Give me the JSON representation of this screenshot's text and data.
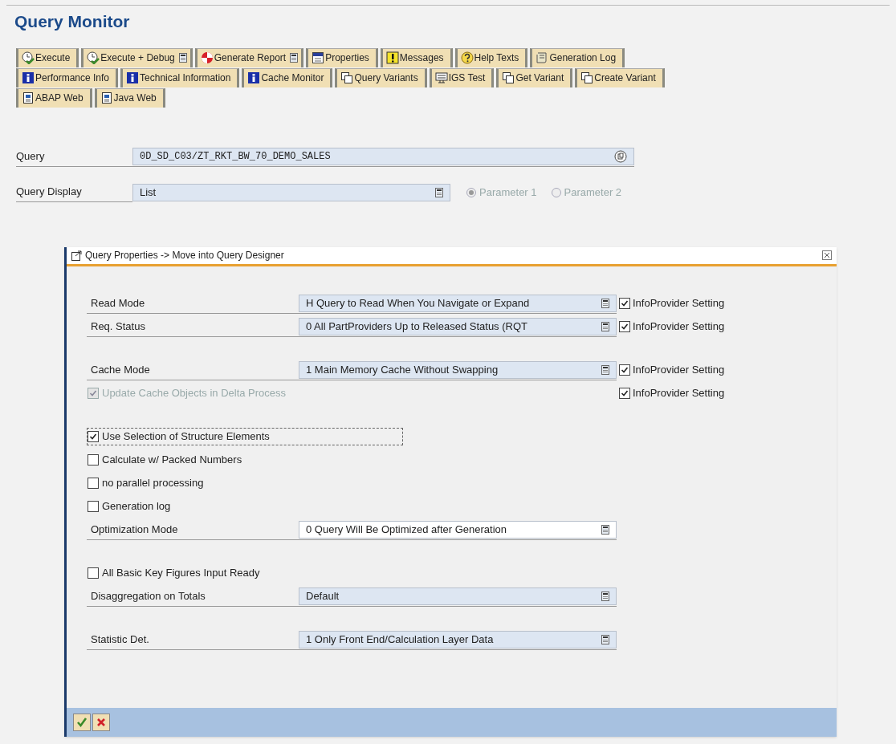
{
  "page": {
    "title": "Query Monitor"
  },
  "toolbar": [
    [
      {
        "label": "Execute",
        "kind": "execute",
        "dropdown": false
      },
      {
        "label": "Execute + Debug",
        "kind": "execute",
        "dropdown": true
      },
      {
        "label": "Generate Report",
        "kind": "generate",
        "dropdown": true
      },
      {
        "label": "Properties",
        "kind": "properties",
        "dropdown": false
      },
      {
        "label": "Messages",
        "kind": "messages",
        "dropdown": false
      },
      {
        "label": "Help Texts",
        "kind": "help",
        "dropdown": false
      },
      {
        "label": "Generation Log",
        "kind": "log",
        "dropdown": false
      }
    ],
    [
      {
        "label": "Performance Info",
        "kind": "info",
        "dropdown": false
      },
      {
        "label": "Technical Information",
        "kind": "info",
        "dropdown": false
      },
      {
        "label": "Cache Monitor",
        "kind": "info",
        "dropdown": false
      },
      {
        "label": "Query Variants",
        "kind": "variant",
        "dropdown": false
      },
      {
        "label": "IGS Test",
        "kind": "igs",
        "dropdown": false
      },
      {
        "label": "Get Variant",
        "kind": "variant",
        "dropdown": false
      },
      {
        "label": "Create Variant",
        "kind": "variant",
        "dropdown": false
      }
    ],
    [
      {
        "label": "ABAP Web",
        "kind": "web",
        "dropdown": false
      },
      {
        "label": "Java Web",
        "kind": "web",
        "dropdown": false
      }
    ]
  ],
  "query": {
    "label": "Query",
    "value": "0D_SD_C03/ZT_RKT_BW_70_DEMO_SALES"
  },
  "query_display": {
    "label": "Query Display",
    "value": "List",
    "radios": [
      {
        "label": "Parameter 1",
        "selected": true,
        "disabled": true
      },
      {
        "label": "Parameter 2",
        "selected": false,
        "disabled": true
      }
    ]
  },
  "dialog": {
    "title": "Query Properties -> Move into Query Designer",
    "groups": [
      [
        {
          "kind": "select",
          "label": "Read Mode",
          "value": "H Query to Read When You Navigate or Expand",
          "infoprovider": {
            "label": "InfoProvider Setting",
            "checked": true
          }
        },
        {
          "kind": "select",
          "label": "Req. Status",
          "value": "0 All PartProviders Up to Released Status (RQT",
          "infoprovider": {
            "label": "InfoProvider Setting",
            "checked": true
          }
        }
      ],
      [
        {
          "kind": "select",
          "label": "Cache Mode",
          "value": "1 Main Memory Cache Without Swapping",
          "infoprovider": {
            "label": "InfoProvider Setting",
            "checked": true
          }
        },
        {
          "kind": "checkbox",
          "label": "Update Cache Objects in Delta Process",
          "checked": true,
          "disabled": true,
          "focused": false,
          "infoprovider": {
            "label": "InfoProvider Setting",
            "checked": true
          }
        }
      ],
      [
        {
          "kind": "checkbox",
          "label": "Use Selection of Structure Elements",
          "checked": true,
          "disabled": false,
          "focused": true
        },
        {
          "kind": "checkbox",
          "label": "Calculate w/ Packed Numbers",
          "checked": false,
          "disabled": false,
          "focused": false
        },
        {
          "kind": "checkbox",
          "label": "no parallel processing",
          "checked": false,
          "disabled": false,
          "focused": false
        },
        {
          "kind": "checkbox",
          "label": "Generation log",
          "checked": false,
          "disabled": false,
          "focused": false
        },
        {
          "kind": "select",
          "label": "Optimization Mode",
          "value": "0 Query Will Be Optimized after Generation"
        }
      ],
      [
        {
          "kind": "checkbox",
          "label": "All Basic Key Figures Input Ready",
          "checked": false,
          "disabled": false,
          "focused": false
        },
        {
          "kind": "select",
          "label": "Disaggregation on Totals",
          "value": "Default"
        }
      ],
      [
        {
          "kind": "select",
          "label": "Statistic Det.",
          "value": "1 Only Front End/Calculation Layer Data"
        }
      ]
    ]
  }
}
